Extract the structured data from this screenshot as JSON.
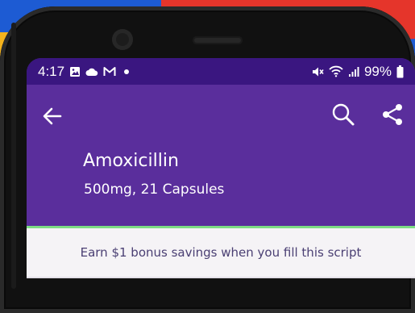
{
  "status_bar": {
    "time": "4:17",
    "battery": "99%",
    "left_icons": [
      "image-icon",
      "cloud-icon",
      "gmail-icon",
      "dot-icon"
    ],
    "right_icons": [
      "mute-icon",
      "wifi-icon",
      "signal-icon",
      "battery-icon"
    ]
  },
  "app_bar": {
    "back_icon": "arrow-left-icon",
    "search_icon": "search-icon",
    "share_icon": "share-icon"
  },
  "drug": {
    "name": "Amoxicillin",
    "detail": "500mg, 21 Capsules"
  },
  "promo": {
    "text": "Earn $1 bonus savings when you fill this script"
  },
  "colors": {
    "header_purple": "#5a2e9c",
    "statusbar_purple": "#3a1680",
    "accent_green": "#7ddc84",
    "promo_text": "#4a3f73"
  }
}
